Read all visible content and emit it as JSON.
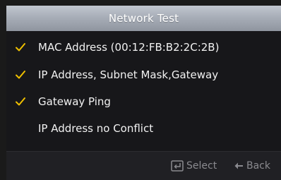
{
  "dialog": {
    "title": "Network Test"
  },
  "checks": [
    {
      "label": "MAC Address (00:12:FB:B2:2C:2B)",
      "status": "passed",
      "icon": "checkmark-icon"
    },
    {
      "label": "IP Address, Subnet Mask,Gateway",
      "status": "passed",
      "icon": "checkmark-icon"
    },
    {
      "label": "Gateway Ping",
      "status": "passed",
      "icon": "checkmark-icon"
    },
    {
      "label": "IP Address no Conflict",
      "status": "pending",
      "icon": ""
    }
  ],
  "footer": {
    "select_label": "Select",
    "select_icon": "enter-key-icon",
    "back_label": "Back",
    "back_icon": "back-arrow-icon"
  },
  "colors": {
    "check": "#f0c000",
    "title_bar": "#a8aeb8",
    "background": "#17171a",
    "hint_text": "#8a8a8f"
  }
}
